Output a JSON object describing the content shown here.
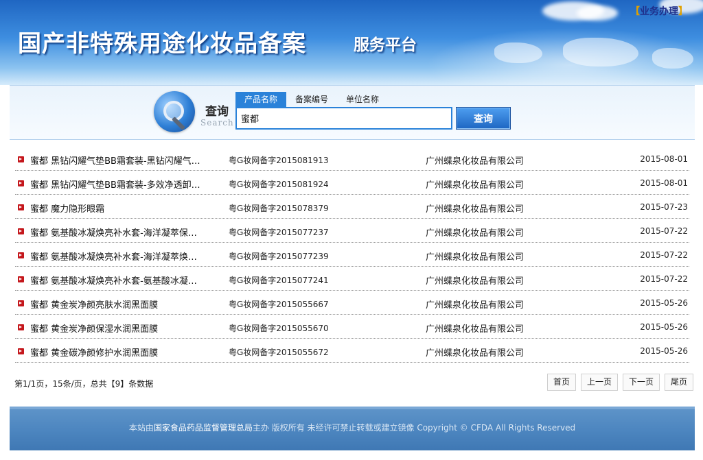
{
  "header": {
    "title": "国产非特殊用途化妆品备案",
    "subtitle": "服务平台",
    "biz_link_open": "【",
    "biz_link_label": "业务办理",
    "biz_link_close": "】"
  },
  "search": {
    "label_cn": "查询",
    "label_en": "Search",
    "tabs": [
      {
        "label": "产品名称",
        "active": true
      },
      {
        "label": "备案编号",
        "active": false
      },
      {
        "label": "单位名称",
        "active": false
      }
    ],
    "value": "蜜都",
    "button_label": "查询"
  },
  "results": [
    {
      "name": "蜜都 黑钻闪耀气垫BB霜套装-黑钻闪耀气…",
      "code": "粤G妆网备字2015081913",
      "company": "广州蝶泉化妆品有限公司",
      "date": "2015-08-01"
    },
    {
      "name": "蜜都 黑钻闪耀气垫BB霜套装-多效净透卸…",
      "code": "粤G妆网备字2015081924",
      "company": "广州蝶泉化妆品有限公司",
      "date": "2015-08-01"
    },
    {
      "name": "蜜都 魔力隐形眼霜",
      "code": "粤G妆网备字2015078379",
      "company": "广州蝶泉化妆品有限公司",
      "date": "2015-07-23"
    },
    {
      "name": "蜜都 氨基酸冰凝焕亮补水套-海洋凝萃保…",
      "code": "粤G妆网备字2015077237",
      "company": "广州蝶泉化妆品有限公司",
      "date": "2015-07-22"
    },
    {
      "name": "蜜都 氨基酸冰凝焕亮补水套-海洋凝萃焕…",
      "code": "粤G妆网备字2015077239",
      "company": "广州蝶泉化妆品有限公司",
      "date": "2015-07-22"
    },
    {
      "name": "蜜都 氨基酸冰凝焕亮补水套-氨基酸冰凝…",
      "code": "粤G妆网备字2015077241",
      "company": "广州蝶泉化妆品有限公司",
      "date": "2015-07-22"
    },
    {
      "name": "蜜都 黄金炭净颜亮肤水润黑面膜",
      "code": "粤G妆网备字2015055667",
      "company": "广州蝶泉化妆品有限公司",
      "date": "2015-05-26"
    },
    {
      "name": "蜜都 黄金炭净颜保湿水润黑面膜",
      "code": "粤G妆网备字2015055670",
      "company": "广州蝶泉化妆品有限公司",
      "date": "2015-05-26"
    },
    {
      "name": "蜜都 黄金碳净颜修护水润黑面膜",
      "code": "粤G妆网备字2015055672",
      "company": "广州蝶泉化妆品有限公司",
      "date": "2015-05-26"
    }
  ],
  "pager": {
    "info": "第1/1页，15条/页，总共【9】条数据",
    "buttons": [
      "首页",
      "上一页",
      "下一页",
      "尾页"
    ]
  },
  "footer": {
    "prefix": "本站由",
    "org": "国家食品药品监督管理总局",
    "suffix": "主办 版权所有 未经许可禁止转载或建立镜像 Copyright © CFDA All Rights Reserved"
  }
}
